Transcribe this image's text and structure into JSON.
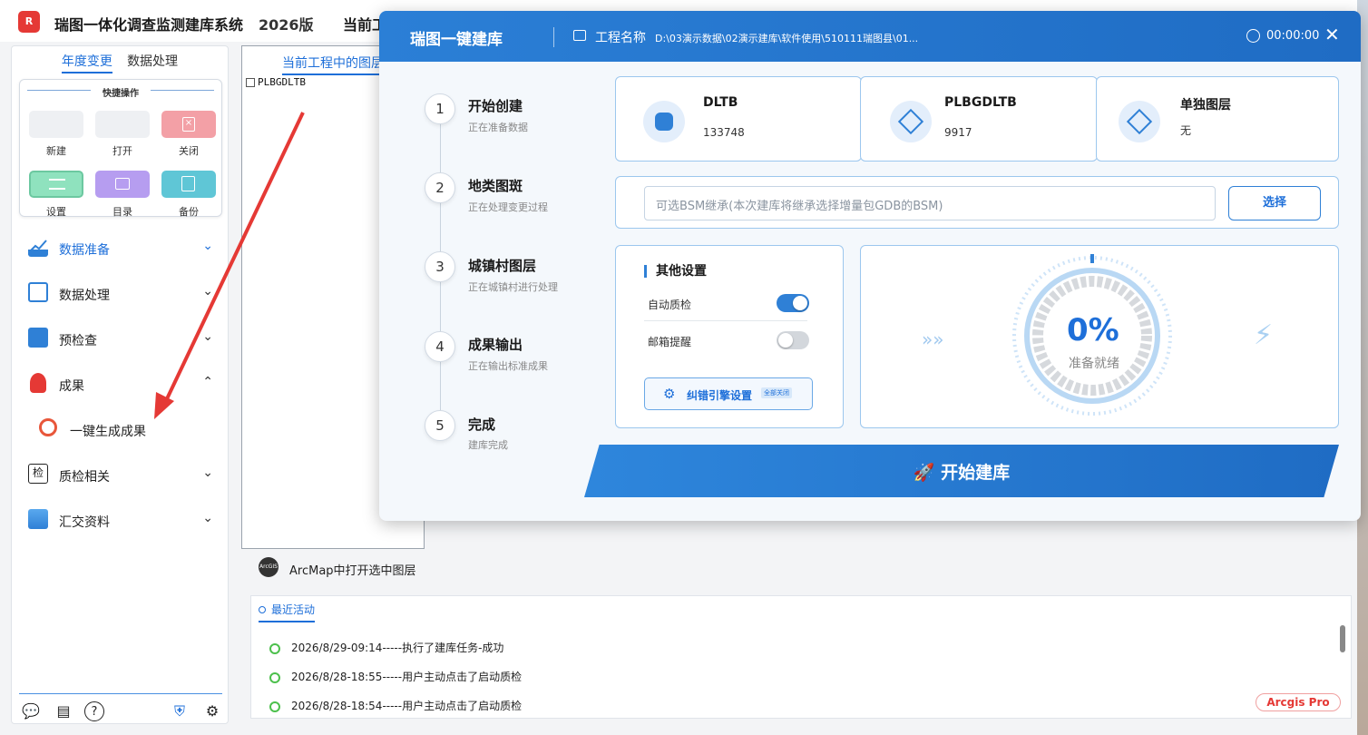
{
  "app": {
    "logo_text": "R",
    "title": "瑞图一体化调查监测建库系统",
    "version": "2026版",
    "current_project": "当前工"
  },
  "sidebar": {
    "tabs": [
      {
        "label": "年度变更",
        "active": true
      },
      {
        "label": "数据处理",
        "active": false
      }
    ],
    "quick_ops": {
      "title": "快捷操作",
      "buttons": [
        {
          "label": "新建",
          "color": "#eef0f3"
        },
        {
          "label": "打开",
          "color": "#eef0f3"
        },
        {
          "label": "关闭",
          "color": "#f3a0a6"
        },
        {
          "label": "设置",
          "color": "#8fe2be"
        },
        {
          "label": "目录",
          "color": "#b69df0"
        },
        {
          "label": "备份",
          "color": "#5fc6d6"
        }
      ]
    },
    "menu": [
      {
        "label": "数据准备",
        "icon": "chart-icon",
        "chevron": "⌄",
        "active": true
      },
      {
        "label": "数据处理",
        "icon": "process-icon",
        "chevron": "⌄"
      },
      {
        "label": "预检查",
        "icon": "precheck-icon",
        "chevron": "⌄"
      },
      {
        "label": "成果",
        "icon": "trophy-icon",
        "chevron": "⌃"
      },
      {
        "label": "一键生成成果",
        "icon": "target-icon",
        "chevron": ""
      },
      {
        "label": "质检相关",
        "icon": "inspect-icon",
        "chevron": "⌄"
      },
      {
        "label": "汇交资料",
        "icon": "submit-icon",
        "chevron": "⌄"
      }
    ],
    "footer_icons": [
      "wechat-icon",
      "log-icon",
      "help-icon",
      "shield-icon",
      "settings-icon"
    ]
  },
  "layers": {
    "tab_label": "当前工程中的图层",
    "items": [
      "PLBGDLTB"
    ]
  },
  "arcmap": {
    "logo_text": "ArcGIS",
    "label": "ArcMap中打开选中图层"
  },
  "activity": {
    "title": "最近活动",
    "items": [
      "2026/8/29-09:14-----执行了建库任务-成功",
      "2026/8/28-18:55-----用户主动点击了启动质检",
      "2026/8/28-18:54-----用户主动点击了启动质检"
    ],
    "badge": "Arcgis Pro"
  },
  "dialog": {
    "title": "瑞图一键建库",
    "project_label": "工程名称",
    "project_path": "D:\\03演示数据\\02演示建库\\软件使用\\510111瑞图县\\01...",
    "timer": "00:00:00",
    "close": "✕",
    "steps": [
      {
        "num": "1",
        "title": "开始创建",
        "sub": "正在准备数据"
      },
      {
        "num": "2",
        "title": "地类图斑",
        "sub": "正在处理变更过程"
      },
      {
        "num": "3",
        "title": "城镇村图层",
        "sub": "正在城镇村进行处理"
      },
      {
        "num": "4",
        "title": "成果输出",
        "sub": "正在输出标准成果"
      },
      {
        "num": "5",
        "title": "完成",
        "sub": "建库完成"
      }
    ],
    "stats": [
      {
        "name": "DLTB",
        "value": "133748"
      },
      {
        "name": "PLBGDLTB",
        "value": "9917"
      },
      {
        "name": "单独图层",
        "value": "无"
      }
    ],
    "bsm_placeholder": "可选BSM继承(本次建库将继承选择增量包GDB的BSM)",
    "bsm_button": "选择",
    "settings": {
      "title": "其他设置",
      "auto_qc_label": "自动质检",
      "auto_qc_on": true,
      "email_label": "邮箱提醒",
      "email_on": false,
      "engine_label": "纠错引擎设置",
      "engine_tag": "全部关闭"
    },
    "progress": {
      "percent_text": "0%",
      "percent": 0,
      "status": "准备就绪"
    },
    "start_button": "开始建库",
    "accent": "#1e6fd9"
  }
}
